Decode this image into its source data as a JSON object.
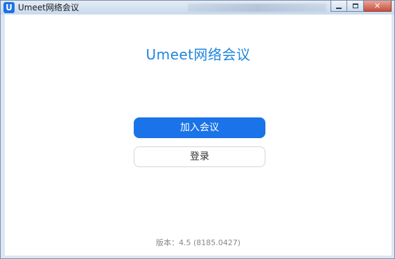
{
  "window": {
    "logo_letter": "U",
    "title": "Umeet网络会议",
    "close_glyph": "✕"
  },
  "main": {
    "heading": "Umeet网络会议",
    "join_button": "加入会议",
    "login_button": "登录",
    "version": "版本：4.5 (8185.0427)"
  },
  "colors": {
    "accent": "#1a73e8",
    "heading": "#1f84e0",
    "version_text": "#888888"
  }
}
